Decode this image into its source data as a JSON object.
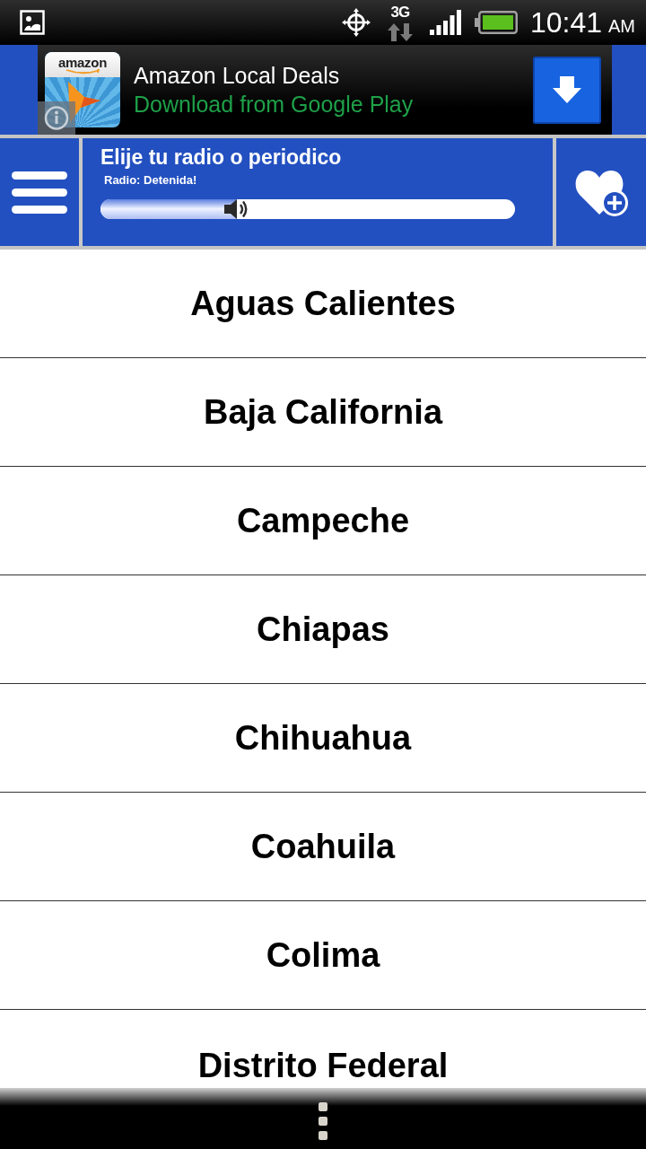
{
  "status_bar": {
    "network_type": "3G",
    "time": "10:41",
    "meridiem": "AM"
  },
  "ad_banner": {
    "icon_label": "amazon",
    "title": "Amazon Local Deals",
    "subtitle": "Download from Google Play"
  },
  "header": {
    "title": "Elije tu radio o periodico",
    "status": "Radio: Detenida!",
    "volume": {
      "level": 0.33
    }
  },
  "regions": [
    {
      "label": "Aguas Calientes"
    },
    {
      "label": "Baja California"
    },
    {
      "label": "Campeche"
    },
    {
      "label": "Chiapas"
    },
    {
      "label": "Chihuahua"
    },
    {
      "label": "Coahuila"
    },
    {
      "label": "Colima"
    },
    {
      "label": "Distrito Federal"
    }
  ]
}
